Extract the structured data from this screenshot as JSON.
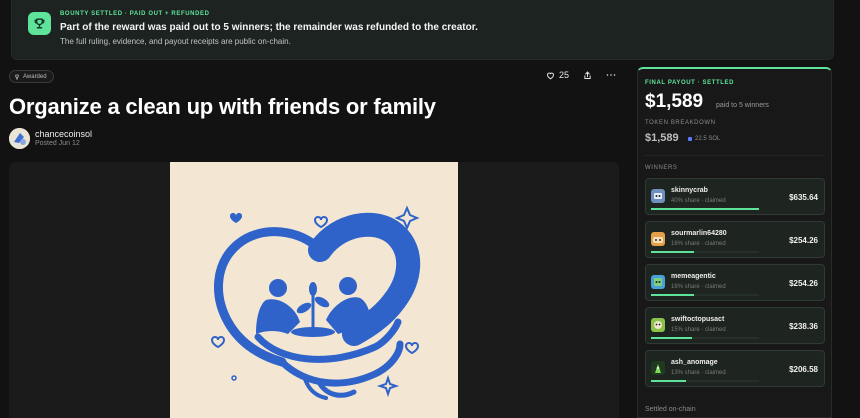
{
  "banner": {
    "kicker": "BOUNTY SETTLED · PAID OUT + REFUNDED",
    "title": "Part of the reward was paid out to 5 winners; the remainder was refunded to the creator.",
    "subtitle": "The full ruling, evidence, and payout receipts are public on-chain.",
    "icon": "trophy-icon"
  },
  "post": {
    "badge": "Awarded",
    "likes": "25",
    "title": "Organize a clean up with friends or family",
    "author": "chancecoinsol",
    "posted": "Posted Jun 12"
  },
  "payout": {
    "kicker": "FINAL PAYOUT · SETTLED",
    "amount": "$1,589",
    "amount_sub": "paid to 5 winners",
    "token_label": "TOKEN BREAKDOWN",
    "token_value": "$1,589",
    "token_sol": "22.5 SOL",
    "winners_label": "WINNERS",
    "footer": "Settled on-chain",
    "winners": [
      {
        "name": "skinnycrab",
        "share": "40% share · claimed",
        "amount": "$635.64",
        "fill": 0.4,
        "avatar_color": "#6f8fbf"
      },
      {
        "name": "sourmarlin64280",
        "share": "16% share · claimed",
        "amount": "$254.26",
        "fill": 0.16,
        "avatar_color": "#e7a04a"
      },
      {
        "name": "memeagentic",
        "share": "16% share · claimed",
        "amount": "$254.26",
        "fill": 0.16,
        "avatar_color": "#4aa0d8"
      },
      {
        "name": "swiftoctopusact",
        "share": "15% share · claimed",
        "amount": "$238.36",
        "fill": 0.15,
        "avatar_color": "#8bc34a"
      },
      {
        "name": "ash_anomage",
        "share": "13% share · claimed",
        "amount": "$206.58",
        "fill": 0.13,
        "avatar_color": "#3d7a3a"
      }
    ]
  },
  "colors": {
    "accent": "#5fe39a",
    "art_blue": "#2f63c9",
    "art_bg": "#f3e7d3"
  }
}
